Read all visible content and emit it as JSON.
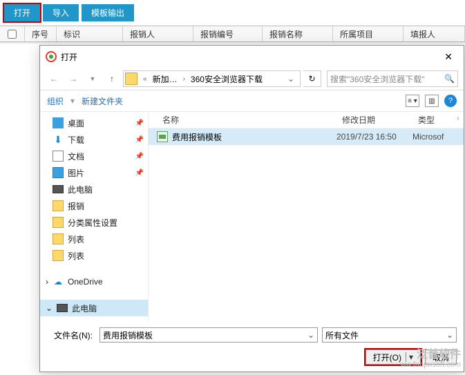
{
  "toolbar": {
    "open": "打开",
    "import": "导入",
    "template_out": "模板输出"
  },
  "grid": {
    "h1": "序号",
    "h2": "标识",
    "h3": "报销人",
    "h4": "报销编号",
    "h5": "报销名称",
    "h6": "所属项目",
    "h7": "填报人"
  },
  "dialog": {
    "title": "打开",
    "crumb1": "新加…",
    "crumb2": "360安全浏览器下载",
    "search_placeholder": "搜索\"360安全浏览器下载\"",
    "organize": "组织",
    "new_folder": "新建文件夹",
    "tree": {
      "desktop": "桌面",
      "download": "下载",
      "docs": "文档",
      "pics": "图片",
      "pc1": "此电脑",
      "f1": "报销",
      "f2": "分类属性设置",
      "f3": "列表",
      "f4": "列表",
      "onedrive": "OneDrive",
      "pc2": "此电脑"
    },
    "list": {
      "hname": "名称",
      "hdate": "修改日期",
      "htype": "类型",
      "row_name": "费用报销模板",
      "row_date": "2019/7/23 16:50",
      "row_type": "Microsof"
    },
    "footer": {
      "label": "文件名(N):",
      "value": "费用报销模板",
      "filter": "所有文件",
      "open": "打开(O)",
      "cancel": "取消"
    }
  },
  "watermark": {
    "brand": "泛普软件",
    "url": "ww.fanpusoft.com"
  }
}
